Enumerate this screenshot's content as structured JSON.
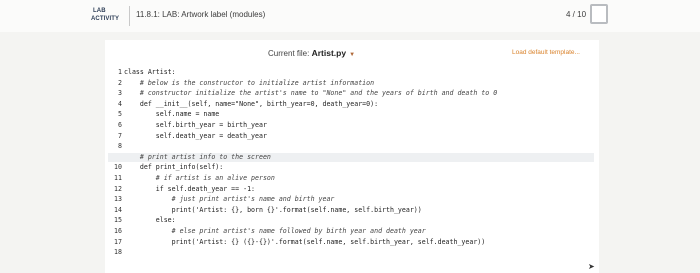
{
  "header": {
    "activity_line1": "LAB",
    "activity_line2": "ACTIVITY",
    "title": "11.8.1: LAB: Artwork label (modules)",
    "score": "4 / 10"
  },
  "editor": {
    "current_file_label": "Current file:",
    "file_name": "Artist.py",
    "load_template": "Load default template..."
  },
  "code_lines": [
    {
      "n": "1",
      "text": "class Artist:"
    },
    {
      "n": "2",
      "text": "    # below is the constructor to initialize artist information"
    },
    {
      "n": "3",
      "text": "    # constructor initialize the artist's name to \"None\" and the years of birth and death to 0"
    },
    {
      "n": "4",
      "text": "    def __init__(self, name=\"None\", birth_year=0, death_year=0):"
    },
    {
      "n": "5",
      "text": "        self.name = name"
    },
    {
      "n": "6",
      "text": "        self.birth_year = birth_year"
    },
    {
      "n": "7",
      "text": "        self.death_year = death_year"
    },
    {
      "n": "8",
      "text": ""
    },
    {
      "n": "9",
      "text": "    # print artist info to the screen"
    },
    {
      "n": "10",
      "text": "    def print_info(self):"
    },
    {
      "n": "11",
      "text": "        # if artist is an alive person"
    },
    {
      "n": "12",
      "text": "        if self.death_year == -1:"
    },
    {
      "n": "13",
      "text": "            # just print artist's name and birth year"
    },
    {
      "n": "14",
      "text": "            print('Artist: {}, born {}'.format(self.name, self.birth_year))"
    },
    {
      "n": "15",
      "text": "        else:"
    },
    {
      "n": "16",
      "text": "            # else print artist's name followed by birth year and death year"
    },
    {
      "n": "17",
      "text": "            print('Artist: {} ({}-{})'.format(self.name, self.birth_year, self.death_year))"
    },
    {
      "n": "18",
      "text": ""
    }
  ]
}
